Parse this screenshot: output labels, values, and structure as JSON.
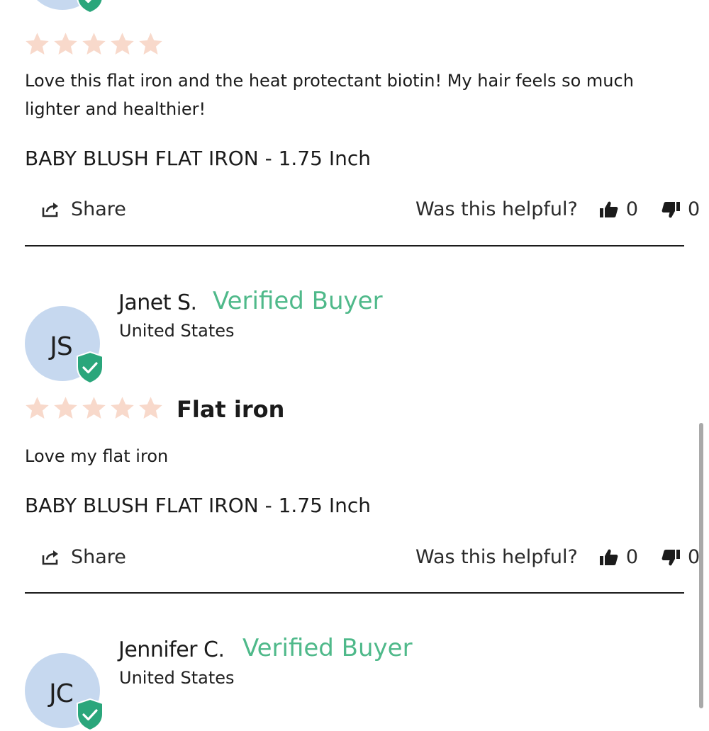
{
  "colors": {
    "star": "#f8d9cb",
    "verified": "#4fb98a",
    "avatar_bg": "#c6d8ef",
    "divider": "#1b1b1b"
  },
  "icons": {
    "rating": "star-icon",
    "verified": "shield-check-icon",
    "share": "share-icon",
    "helpful_yes": "thumbs-up-icon",
    "helpful_no": "thumbs-down-icon"
  },
  "reviews": [
    {
      "rating": 5,
      "body": "Love this flat iron and the heat protectant biotin! My hair feels so much lighter and healthier!",
      "variant": "BABY BLUSH FLAT IRON - 1.75 Inch",
      "share_label": "Share",
      "helpful_label": "Was this helpful?",
      "yes_count": "0",
      "no_count": "0"
    },
    {
      "initials": "JS",
      "name": "Janet S.",
      "verified_label": "Verified Buyer",
      "country": "United States",
      "rating": 5,
      "title": "Flat iron",
      "body": "Love my flat iron",
      "variant": "BABY BLUSH FLAT IRON - 1.75 Inch",
      "share_label": "Share",
      "helpful_label": "Was this helpful?",
      "yes_count": "0",
      "no_count": "0"
    },
    {
      "initials": "JC",
      "name": "Jennifer C.",
      "verified_label": "Verified Buyer",
      "country": "United States"
    }
  ]
}
